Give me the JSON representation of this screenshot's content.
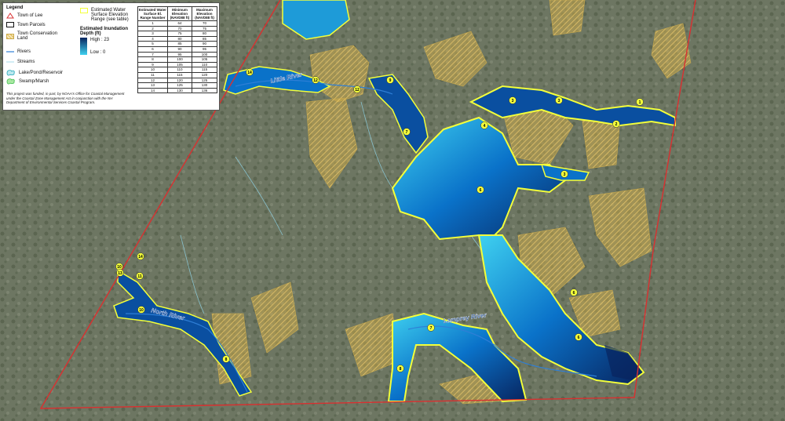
{
  "legend": {
    "title": "Legend",
    "items": [
      {
        "label": "Town of Lee",
        "icon": "town-boundary-icon"
      },
      {
        "label": "Town Parcels",
        "icon": "parcel-icon"
      },
      {
        "label": "Town Conservation Land",
        "icon": "conservation-hatch-icon"
      },
      {
        "label": "Rivers",
        "icon": "river-line-icon"
      },
      {
        "label": "Streams",
        "icon": "stream-line-icon"
      },
      {
        "label": "Lake/Pond/Reservoir",
        "icon": "lake-icon"
      },
      {
        "label": "Swamp/Marsh",
        "icon": "swamp-icon"
      }
    ],
    "wse_label": "Estimated Water Surface Elevation Range (see table)",
    "depth_title": "Estimated Inundation Depth (ft)",
    "depth_high": "High : 23",
    "depth_low": "Low : 0",
    "note": "This project was funded, in part, by NOAA's Office for Coastal Management under the Coastal Zone Management Act in conjunction with the NH Department of Environmental Services Coastal Program."
  },
  "range_table": {
    "headers": [
      "Estimated Water Surface El. Range Number",
      "Minimum Elevation (NAVD88 ft)",
      "Maximum Elevation (NAVD88 ft)"
    ],
    "rows": [
      [
        "1",
        "64",
        "70"
      ],
      [
        "2",
        "70",
        "75"
      ],
      [
        "3",
        "75",
        "80"
      ],
      [
        "4",
        "80",
        "85"
      ],
      [
        "5",
        "85",
        "90"
      ],
      [
        "6",
        "90",
        "95"
      ],
      [
        "7",
        "95",
        "100"
      ],
      [
        "8",
        "100",
        "105"
      ],
      [
        "9",
        "105",
        "110"
      ],
      [
        "10",
        "110",
        "115"
      ],
      [
        "11",
        "115",
        "120"
      ],
      [
        "12",
        "120",
        "125"
      ],
      [
        "13",
        "125",
        "130"
      ],
      [
        "14",
        "130",
        "136"
      ]
    ]
  },
  "river_labels": [
    "Little River",
    "North River",
    "Lamprey River"
  ],
  "range_markers": [
    "14",
    "13",
    "12",
    "11",
    "10",
    "9",
    "8",
    "7",
    "6",
    "5",
    "4",
    "3",
    "2",
    "1"
  ],
  "colors": {
    "boundary": "#d93030",
    "deep": "#08245e",
    "shallow": "#3fd1f0",
    "wse_outline": "#f3ff3a",
    "conservation": "#c9a94b",
    "imagery": "#6f7763"
  }
}
